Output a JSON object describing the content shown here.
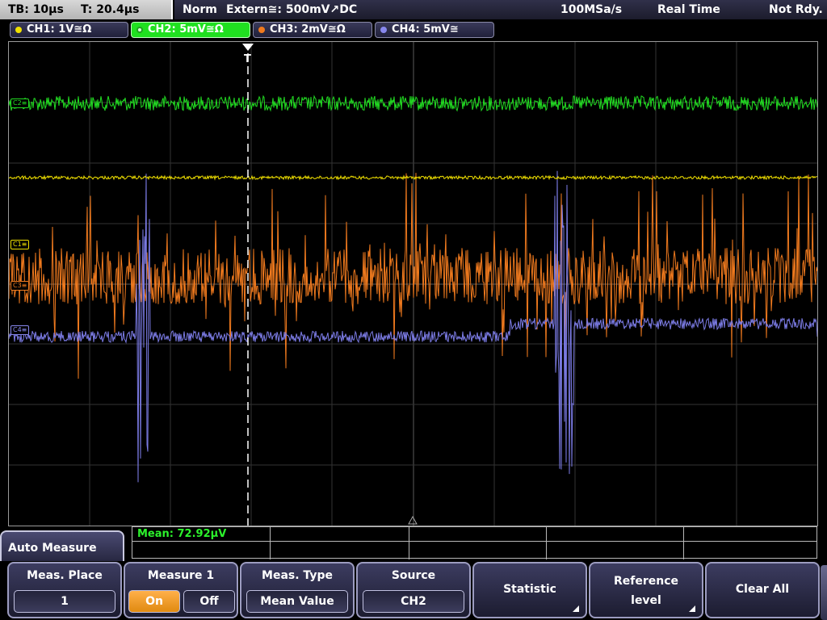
{
  "status": {
    "timebase": "TB: 10µs",
    "trigger_time": "T: 20.4µs",
    "trigger_mode": "Norm",
    "trigger_source": "Extern≅: 500mV↗DC",
    "sample_rate": "100MSa/s",
    "acq_mode": "Real Time",
    "state": "Not Rdy."
  },
  "channels": [
    {
      "label": "CH1: 1V≅Ω",
      "color": "#f0e000"
    },
    {
      "label": "CH2: 5mV≅Ω",
      "color": "#22dd22"
    },
    {
      "label": "CH3: 2mV≅Ω",
      "color": "#f07a1e"
    },
    {
      "label": "CH4: 5mV≅",
      "color": "#8888ee"
    }
  ],
  "markers": {
    "c2": "C2≡",
    "c1": "C1≡",
    "c3": "C3≡",
    "c4": "C4≡",
    "trigger": "T"
  },
  "measurement": {
    "readout": "Mean: 72.92µV"
  },
  "menu": {
    "title": "Auto Measure",
    "meas_place": {
      "label": "Meas. Place",
      "value": "1"
    },
    "measure1": {
      "label": "Measure 1",
      "on": "On",
      "off": "Off"
    },
    "meas_type": {
      "label": "Meas. Type",
      "value": "Mean Value"
    },
    "source": {
      "label": "Source",
      "value": "CH2"
    },
    "statistic": "Statistic",
    "reference_level": {
      "line1": "Reference",
      "line2": "level"
    },
    "clear_all": "Clear All"
  }
}
